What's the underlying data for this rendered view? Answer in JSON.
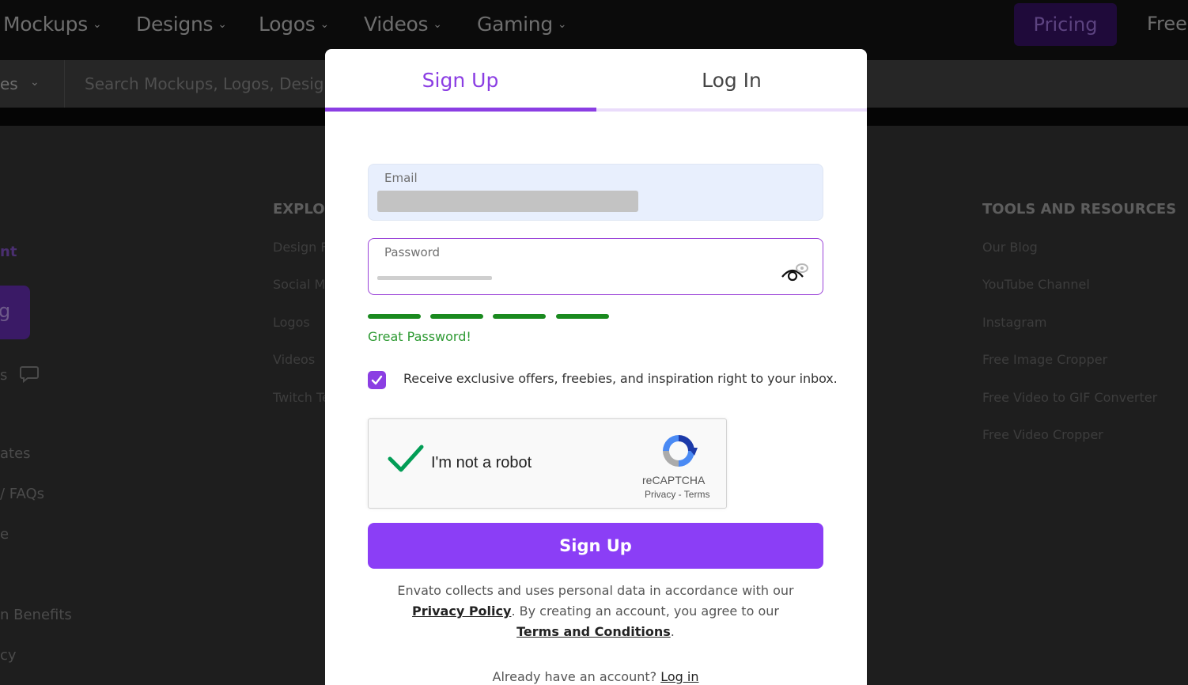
{
  "topnav": {
    "items": [
      {
        "label": "Mockups"
      },
      {
        "label": "Designs"
      },
      {
        "label": "Logos"
      },
      {
        "label": "Videos"
      },
      {
        "label": "Gaming"
      }
    ],
    "pricing_label": "Pricing",
    "free_label": "Free A"
  },
  "search": {
    "category_label": "es",
    "placeholder": "Search Mockups, Logos, Design T"
  },
  "background": {
    "left_items": [
      {
        "label": "nt"
      },
      {
        "label": "g"
      },
      {
        "label": "s"
      },
      {
        "label": "ates"
      },
      {
        "label": "/ FAQs"
      },
      {
        "label": "e"
      },
      {
        "label": "n Benefits"
      },
      {
        "label": "cy"
      }
    ],
    "explore": {
      "heading": "EXPLOR",
      "links": [
        "Design Fi",
        "Social M",
        "Logos",
        "Videos",
        "Twitch Te"
      ]
    },
    "tools": {
      "heading": "TOOLS AND RESOURCES",
      "links": [
        "Our Blog",
        "YouTube Channel",
        "Instagram",
        "Free Image Cropper",
        "Free Video to GIF Converter",
        "Free Video Cropper"
      ]
    }
  },
  "modal": {
    "tabs": [
      {
        "label": "Sign Up",
        "active": true
      },
      {
        "label": "Log In",
        "active": false
      }
    ],
    "email": {
      "label": "Email"
    },
    "password": {
      "label": "Password"
    },
    "strength": {
      "level": 4,
      "max": 4,
      "message": "Great Password!"
    },
    "optin": {
      "checked": true,
      "label": "Receive exclusive offers, freebies, and inspiration right to your inbox."
    },
    "recaptcha": {
      "label": "I'm not a robot",
      "brand": "reCAPTCHA",
      "links": "Privacy - Terms"
    },
    "submit_label": "Sign Up",
    "legal": {
      "line1": "Envato collects and uses personal data in accordance with our",
      "privacy_link": "Privacy Policy",
      "line2": ". By creating an account, you agree to our",
      "terms_link": "Terms and Conditions",
      "end": "."
    },
    "already": {
      "text": "Already have an account?",
      "link": "Log in"
    }
  },
  "colors": {
    "accent": "#8b3ee3",
    "button": "#8b3ef6",
    "strength": "#1a8a1f"
  }
}
